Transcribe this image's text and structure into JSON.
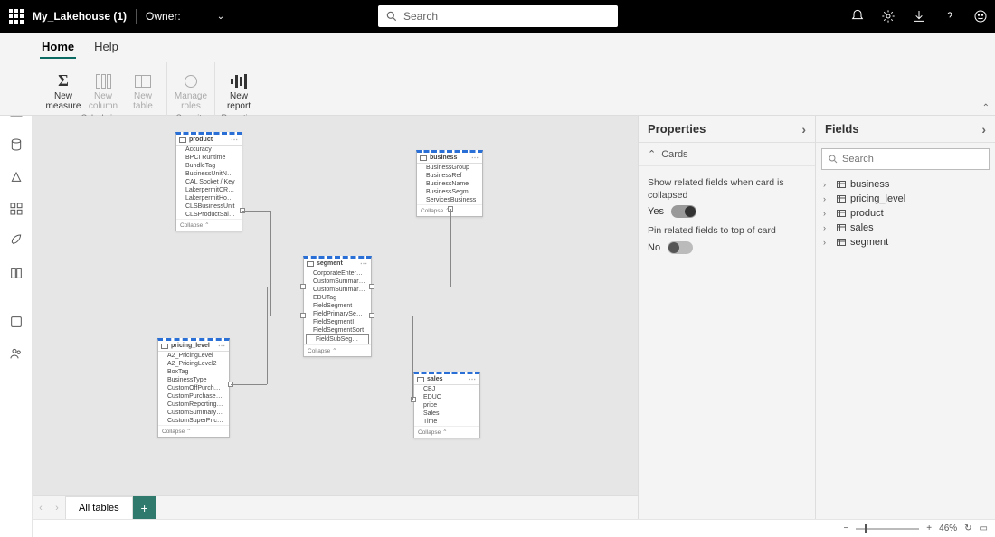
{
  "topbar": {
    "title": "My_Lakehouse (1)",
    "owner_label": "Owner:",
    "search_placeholder": "Search"
  },
  "ribbon": {
    "tabs": {
      "home": "Home",
      "help": "Help"
    },
    "buttons": {
      "new_measure_l1": "New",
      "new_measure_l2": "measure",
      "new_column_l1": "New",
      "new_column_l2": "column",
      "new_table_l1": "New",
      "new_table_l2": "table",
      "manage_roles_l1": "Manage",
      "manage_roles_l2": "roles",
      "new_report_l1": "New",
      "new_report_l2": "report"
    },
    "groups": {
      "calculations": "Calculations",
      "security": "Security",
      "reporting": "Reporting"
    }
  },
  "canvas": {
    "tab_label": "All tables",
    "collapse_label": "Collapse",
    "tables": {
      "product": {
        "name": "product",
        "fields": [
          "Accuracy",
          "BPCI Runtime",
          "BundleTag",
          "BusinessUnitName",
          "CAL Socket / Key",
          "LakerpermitCRMSold",
          "LakerpermitHomel",
          "CLSBusinessUnit",
          "CLSProductSalesaddedDevices"
        ]
      },
      "business": {
        "name": "business",
        "fields": [
          "BusinessGroup",
          "BusinessRef",
          "BusinessName",
          "BusinessSegmentName",
          "ServicesBusiness"
        ]
      },
      "segment": {
        "name": "segment",
        "fields": [
          "CorporateEnterpriseTag",
          "CustomSummarySector",
          "CustomSummarySegment",
          "EDUTag",
          "FieldSegment",
          "FieldPrimarySegment",
          "FieldSegmentI",
          "FieldSegmentSort",
          "FieldSubSegment"
        ]
      },
      "pricing_level": {
        "name": "pricing_level",
        "fields": [
          "A2_PricingLevel",
          "A2_PricingLevel2",
          "BoxTag",
          "BusinessType",
          "CustomOffPurchaseType",
          "CustomPurchaseType",
          "CustomReportingSummaryPurch",
          "CustomSummaryPurchaseType",
          "CustomSuperPricingLevel"
        ]
      },
      "sales": {
        "name": "sales",
        "fields": [
          "CBJ",
          "EDUC",
          "price",
          "Sales",
          "Time"
        ]
      }
    }
  },
  "properties": {
    "title": "Properties",
    "section": "Cards",
    "show_related_label": "Show related fields when card is collapsed",
    "show_related_value": "Yes",
    "pin_related_label": "Pin related fields to top of card",
    "pin_related_value": "No"
  },
  "fields": {
    "title": "Fields",
    "search_placeholder": "Search",
    "items": [
      "business",
      "pricing_level",
      "product",
      "sales",
      "segment"
    ]
  },
  "status": {
    "zoom": "46%"
  }
}
